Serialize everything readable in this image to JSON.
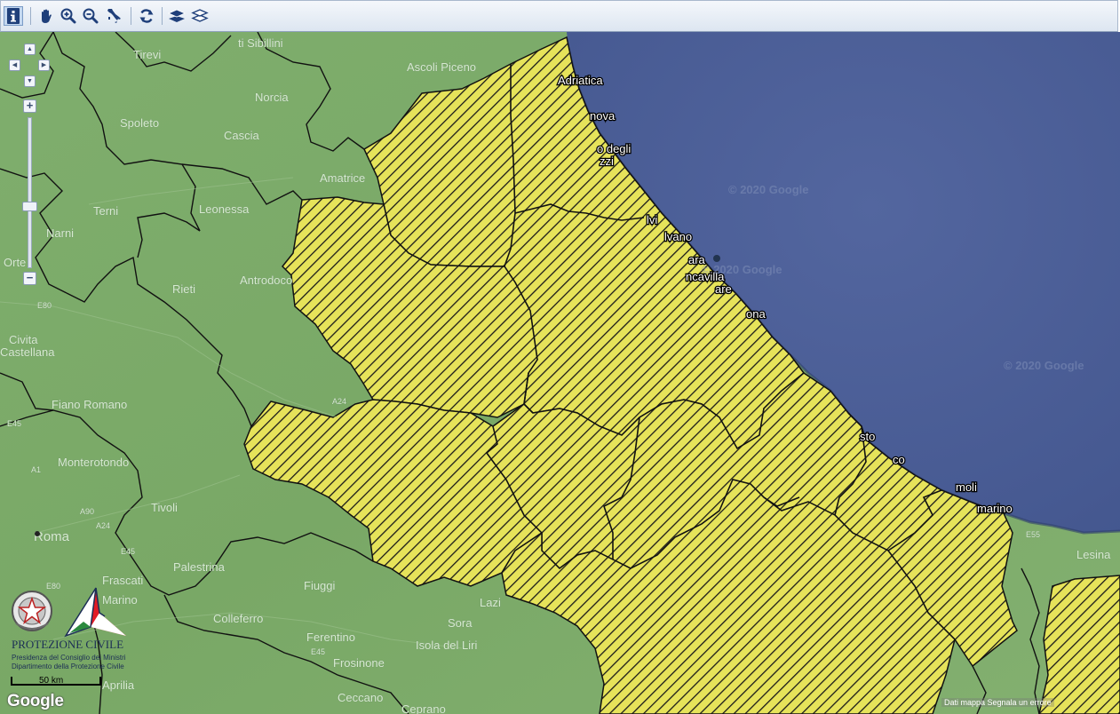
{
  "toolbar": {
    "buttons": [
      {
        "name": "info-button",
        "icon": "info-icon",
        "active": true
      },
      {
        "name": "pan-button",
        "icon": "hand-icon"
      },
      {
        "name": "zoom-in-button",
        "icon": "zoom-in-icon"
      },
      {
        "name": "zoom-out-button",
        "icon": "zoom-out-icon"
      },
      {
        "name": "italy-full-extent-button",
        "icon": "italy-icon"
      },
      {
        "name": "refresh-button",
        "icon": "refresh-icon"
      },
      {
        "name": "layers-button",
        "icon": "layers-icon"
      },
      {
        "name": "layers-outline-button",
        "icon": "layers-outline-icon"
      }
    ]
  },
  "map": {
    "colors": {
      "sea": "#4b5e9c",
      "land": "#7cab6a",
      "alert_zone": "#e6e35a",
      "hatch": "#1a1a1a",
      "border": "#111111"
    },
    "place_labels": [
      {
        "id": "tirevi",
        "text": "Tirevi"
      },
      {
        "id": "ascoli",
        "text": "Ascoli Piceno"
      },
      {
        "id": "sibillini",
        "text": "ti Sibillini"
      },
      {
        "id": "spoleto",
        "text": "Spoleto"
      },
      {
        "id": "norcia",
        "text": "Norcia"
      },
      {
        "id": "cascia",
        "text": "Cascia"
      },
      {
        "id": "amatrice",
        "text": "Amatrice"
      },
      {
        "id": "terni",
        "text": "Terni"
      },
      {
        "id": "leonessa",
        "text": "Leonessa"
      },
      {
        "id": "narni",
        "text": "Narni"
      },
      {
        "id": "orte",
        "text": "Orte"
      },
      {
        "id": "rieti",
        "text": "Rieti"
      },
      {
        "id": "antrodoco",
        "text": "Antrodoco"
      },
      {
        "id": "civita1",
        "text": "Civita"
      },
      {
        "id": "civita2",
        "text": "Castellana"
      },
      {
        "id": "fiano",
        "text": "Fiano Romano"
      },
      {
        "id": "monterotondo",
        "text": "Monterotondo"
      },
      {
        "id": "tivoli",
        "text": "Tivoli"
      },
      {
        "id": "roma",
        "text": "Roma"
      },
      {
        "id": "palestrina",
        "text": "Palestrina"
      },
      {
        "id": "frascati",
        "text": "Frascati"
      },
      {
        "id": "marino",
        "text": "Marino"
      },
      {
        "id": "colleferro",
        "text": "Colleferro"
      },
      {
        "id": "fiuggi",
        "text": "Fiuggi"
      },
      {
        "id": "ferentino",
        "text": "Ferentino"
      },
      {
        "id": "frosinone",
        "text": "Frosinone"
      },
      {
        "id": "isola",
        "text": "Isola del Liri"
      },
      {
        "id": "sora",
        "text": "Sora"
      },
      {
        "id": "ceccano",
        "text": "Ceccano"
      },
      {
        "id": "aprilia",
        "text": "Aprilia"
      },
      {
        "id": "ceprano",
        "text": "Ceprano"
      },
      {
        "id": "lazi",
        "text": "Lazi"
      },
      {
        "id": "lesina",
        "text": "Lesina"
      },
      {
        "id": "a24",
        "text": "A24"
      },
      {
        "id": "e80",
        "text": "E80"
      },
      {
        "id": "a1",
        "text": "A1"
      },
      {
        "id": "e45",
        "text": "E45"
      },
      {
        "id": "a90",
        "text": "A90"
      },
      {
        "id": "a24b",
        "text": "A24"
      },
      {
        "id": "e45b",
        "text": "E45"
      },
      {
        "id": "e55",
        "text": "E55"
      },
      {
        "id": "e80b",
        "text": "E80"
      },
      {
        "id": "e45c",
        "text": "E45"
      }
    ],
    "coast_labels": [
      {
        "id": "adriatica",
        "text": "Adriatica"
      },
      {
        "id": "nova",
        "text": "nova"
      },
      {
        "id": "degli1",
        "text": "o degli"
      },
      {
        "id": "degli2",
        "text": "zzi"
      },
      {
        "id": "silvi",
        "text": "lvi"
      },
      {
        "id": "silvano",
        "text": "lvano"
      },
      {
        "id": "pescara",
        "text": "ara"
      },
      {
        "id": "francavilla",
        "text": "ncavilla"
      },
      {
        "id": "mare",
        "text": "are"
      },
      {
        "id": "ortona",
        "text": "ona"
      },
      {
        "id": "vasto",
        "text": "sto"
      },
      {
        "id": "sanSalvo",
        "text": "co"
      },
      {
        "id": "termoli",
        "text": "moli"
      },
      {
        "id": "marino2",
        "text": "marino"
      }
    ],
    "watermarks": [
      {
        "id": "wm1",
        "text": "© 2020 Google"
      },
      {
        "id": "wm2",
        "text": "© 2020 Google"
      },
      {
        "id": "wm3",
        "text": "© 2020 Google"
      }
    ]
  },
  "navigation": {
    "pan_up": "▲",
    "pan_left": "◀",
    "pan_right": "▶",
    "pan_down": "▼",
    "zoom_in": "+",
    "zoom_out": "−"
  },
  "logo": {
    "name": "PROTEZIONE CIVILE",
    "line1": "Presidenza del Consiglio dei Ministri",
    "line2": "Dipartimento della Protezione Civile"
  },
  "scale": {
    "label": "50 km"
  },
  "google_logo": "Google",
  "attribution": "Dati mappa   Segnala un errore"
}
